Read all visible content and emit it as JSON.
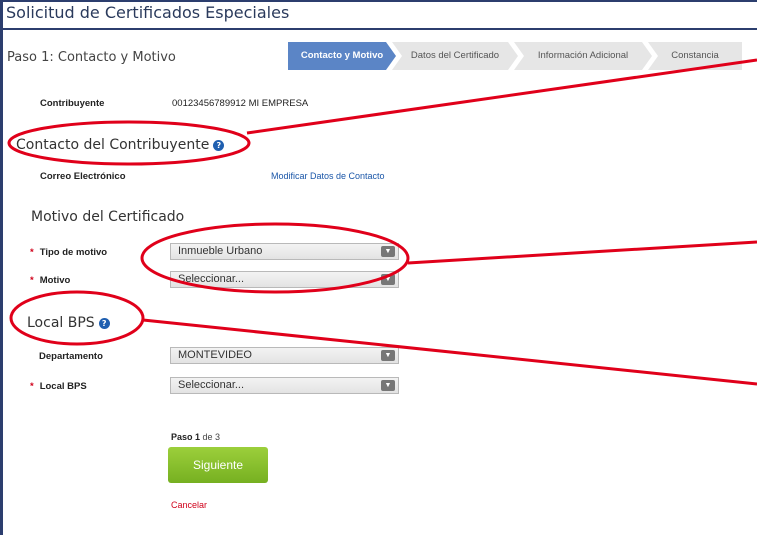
{
  "window": {
    "title": "Solicitud de Certificados Especiales"
  },
  "step_title": "Paso 1: Contacto y Motivo",
  "stepper": [
    {
      "label": "Contacto y Motivo",
      "active": true
    },
    {
      "label": "Datos del Certificado",
      "active": false
    },
    {
      "label": "Información Adicional",
      "active": false
    },
    {
      "label": "Constancia",
      "active": false
    }
  ],
  "contribuyente": {
    "label": "Contribuyente",
    "value": "00123456789912 MI EMPRESA"
  },
  "contacto": {
    "heading": "Contacto del Contribuyente",
    "email_label": "Correo Electrónico",
    "modify_link": "Modificar Datos de Contacto"
  },
  "motivo": {
    "heading": "Motivo del Certificado",
    "tipo_label": "Tipo de motivo",
    "tipo_value": "Inmueble Urbano",
    "motivo_label": "Motivo",
    "motivo_value": "Seleccionar..."
  },
  "local": {
    "heading": "Local BPS",
    "depto_label": "Departamento",
    "depto_value": "MONTEVIDEO",
    "local_label": "Local BPS",
    "local_value": "Seleccionar..."
  },
  "pager": {
    "prefix": "Paso ",
    "current": "1",
    "suffix": " de 3"
  },
  "buttons": {
    "next": "Siguiente",
    "cancel": "Cancelar"
  },
  "colors": {
    "accent": "#5b85c6",
    "success": "#76b021",
    "annotation": "#e0001a",
    "link": "#1a56a8"
  }
}
